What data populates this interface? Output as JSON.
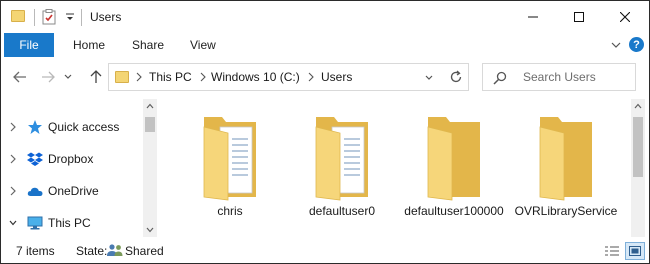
{
  "window": {
    "title": "Users"
  },
  "ribbon": {
    "file_label": "File",
    "tabs": [
      {
        "label": "Home"
      },
      {
        "label": "Share"
      },
      {
        "label": "View"
      }
    ]
  },
  "address": {
    "crumbs": [
      {
        "label": "This PC"
      },
      {
        "label": "Windows 10 (C:)"
      },
      {
        "label": "Users"
      }
    ]
  },
  "search": {
    "placeholder": "Search Users"
  },
  "nav": {
    "items": [
      {
        "label": "Quick access",
        "icon": "star-icon",
        "expanded": false
      },
      {
        "label": "Dropbox",
        "icon": "dropbox-icon",
        "expanded": false
      },
      {
        "label": "OneDrive",
        "icon": "cloud-icon",
        "expanded": false
      },
      {
        "label": "This PC",
        "icon": "computer-icon",
        "expanded": true
      }
    ]
  },
  "content": {
    "items": [
      {
        "label": "chris",
        "icon": "folder-with-files-icon"
      },
      {
        "label": "defaultuser0",
        "icon": "folder-with-files-icon"
      },
      {
        "label": "defaultuser100000",
        "icon": "folder-icon"
      },
      {
        "label": "OVRLibraryService",
        "icon": "folder-icon"
      }
    ]
  },
  "status": {
    "item_count": "7 items",
    "state_label": "State:",
    "state_value": "Shared"
  },
  "colors": {
    "accent": "#1979ca",
    "folder": "#f4d574"
  }
}
